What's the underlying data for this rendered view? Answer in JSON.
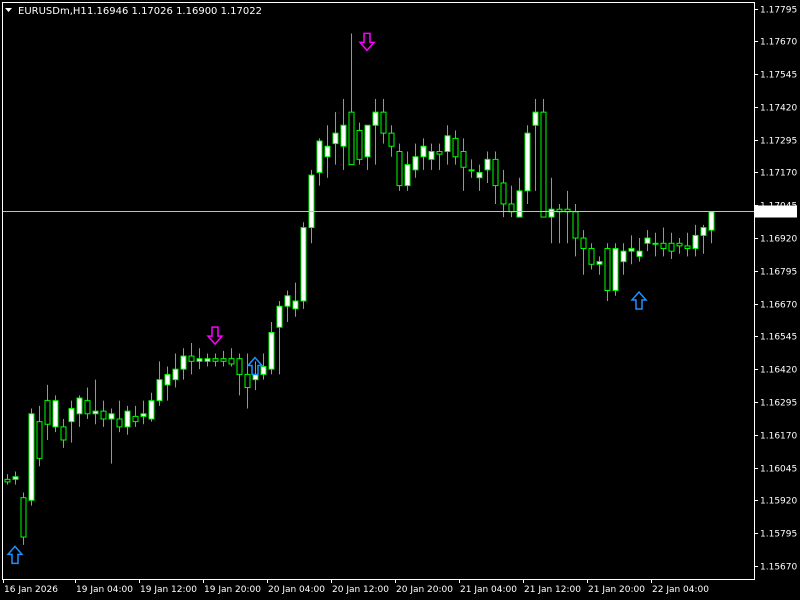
{
  "header": {
    "symbol_timeframe": "EURUSDm,H1",
    "ohlc": "1.16946 1.17026 1.16900 1.17022",
    "menu_icon": "triangle-down-icon"
  },
  "price_tag": "1.17022",
  "colors": {
    "background": "#000000",
    "frame": "#ffffff",
    "candle": "#00ff00",
    "bull_body": "#ffffff",
    "bear_body": "#000000",
    "bid_line": "#c0c0c0",
    "down_arrow": "#ff00ff",
    "up_arrow": "#1e90ff"
  },
  "chart_data": {
    "type": "candlestick",
    "symbol": "EURUSDm",
    "timeframe": "H1",
    "ylim": [
      1.1562,
      1.1782
    ],
    "y_ticks": [
      "1.17795",
      "1.17670",
      "1.17545",
      "1.17420",
      "1.17295",
      "1.17170",
      "1.17045",
      "1.16920",
      "1.16795",
      "1.16670",
      "1.16545",
      "1.16420",
      "1.16295",
      "1.16170",
      "1.16045",
      "1.15920",
      "1.15795",
      "1.15670"
    ],
    "y_tick_values": [
      1.17795,
      1.1767,
      1.17545,
      1.1742,
      1.17295,
      1.1717,
      1.17045,
      1.1692,
      1.16795,
      1.1667,
      1.16545,
      1.1642,
      1.16295,
      1.1617,
      1.16045,
      1.1592,
      1.15795,
      1.1567
    ],
    "x_tick_labels": [
      "16 Jan 2026",
      "19 Jan 04:00",
      "19 Jan 12:00",
      "19 Jan 20:00",
      "20 Jan 04:00",
      "20 Jan 12:00",
      "20 Jan 20:00",
      "21 Jan 04:00",
      "21 Jan 12:00",
      "21 Jan 20:00",
      "22 Jan 04:00"
    ],
    "x_tick_bar_index": [
      0,
      9,
      17,
      25,
      33,
      41,
      49,
      57,
      65,
      73,
      81
    ],
    "current_bid": 1.17022,
    "candles": [
      [
        1.16,
        1.1602,
        1.1598,
        1.1599
      ],
      [
        1.16,
        1.1603,
        1.1598,
        1.1601
      ],
      [
        1.1593,
        1.1595,
        1.1575,
        1.1578
      ],
      [
        1.1592,
        1.1627,
        1.159,
        1.1625
      ],
      [
        1.1622,
        1.1628,
        1.1605,
        1.1608
      ],
      [
        1.163,
        1.1636,
        1.1615,
        1.1621
      ],
      [
        1.162,
        1.1632,
        1.1618,
        1.163
      ],
      [
        1.162,
        1.1623,
        1.1612,
        1.1615
      ],
      [
        1.1622,
        1.163,
        1.1614,
        1.1627
      ],
      [
        1.1625,
        1.1632,
        1.162,
        1.1631
      ],
      [
        1.163,
        1.1635,
        1.1623,
        1.1625
      ],
      [
        1.1625,
        1.1638,
        1.1621,
        1.1626
      ],
      [
        1.1626,
        1.163,
        1.162,
        1.1623
      ],
      [
        1.1623,
        1.1627,
        1.1606,
        1.1625
      ],
      [
        1.1623,
        1.163,
        1.1618,
        1.162
      ],
      [
        1.162,
        1.1628,
        1.1617,
        1.1626
      ],
      [
        1.1624,
        1.1628,
        1.162,
        1.1622
      ],
      [
        1.1624,
        1.163,
        1.1621,
        1.1625
      ],
      [
        1.1623,
        1.1633,
        1.1622,
        1.163
      ],
      [
        1.163,
        1.1645,
        1.1628,
        1.1638
      ],
      [
        1.1636,
        1.1643,
        1.163,
        1.164
      ],
      [
        1.1638,
        1.1648,
        1.1635,
        1.1642
      ],
      [
        1.1642,
        1.165,
        1.1638,
        1.1647
      ],
      [
        1.1647,
        1.1652,
        1.164,
        1.1645
      ],
      [
        1.1645,
        1.165,
        1.1642,
        1.1646
      ],
      [
        1.1645,
        1.1648,
        1.1643,
        1.1646
      ],
      [
        1.1646,
        1.1648,
        1.1643,
        1.1645
      ],
      [
        1.1646,
        1.1649,
        1.1643,
        1.1645
      ],
      [
        1.1646,
        1.165,
        1.1643,
        1.1644
      ],
      [
        1.1646,
        1.1648,
        1.1632,
        1.164
      ],
      [
        1.164,
        1.1648,
        1.1627,
        1.1635
      ],
      [
        1.1638,
        1.1645,
        1.1634,
        1.164
      ],
      [
        1.164,
        1.1648,
        1.1638,
        1.1643
      ],
      [
        1.1642,
        1.166,
        1.164,
        1.1656
      ],
      [
        1.1658,
        1.1668,
        1.164,
        1.1666
      ],
      [
        1.1666,
        1.1672,
        1.166,
        1.167
      ],
      [
        1.1665,
        1.1675,
        1.1662,
        1.1668
      ],
      [
        1.1668,
        1.1698,
        1.1665,
        1.1696
      ],
      [
        1.1696,
        1.1718,
        1.169,
        1.1716
      ],
      [
        1.1717,
        1.173,
        1.1712,
        1.1729
      ],
      [
        1.1723,
        1.1735,
        1.1715,
        1.1727
      ],
      [
        1.1728,
        1.174,
        1.172,
        1.1732
      ],
      [
        1.1727,
        1.1745,
        1.1718,
        1.1735
      ],
      [
        1.174,
        1.177,
        1.172,
        1.172
      ],
      [
        1.1733,
        1.1736,
        1.172,
        1.1722
      ],
      [
        1.1723,
        1.1735,
        1.1718,
        1.1735
      ],
      [
        1.1735,
        1.1745,
        1.172,
        1.174
      ],
      [
        1.174,
        1.1745,
        1.1728,
        1.1732
      ],
      [
        1.1732,
        1.1735,
        1.1723,
        1.1727
      ],
      [
        1.1725,
        1.1728,
        1.171,
        1.1712
      ],
      [
        1.1712,
        1.1725,
        1.171,
        1.172
      ],
      [
        1.1718,
        1.1728,
        1.1715,
        1.1723
      ],
      [
        1.1723,
        1.173,
        1.1718,
        1.1727
      ],
      [
        1.1722,
        1.1728,
        1.1718,
        1.1725
      ],
      [
        1.1725,
        1.1728,
        1.1718,
        1.1724
      ],
      [
        1.1725,
        1.1735,
        1.172,
        1.1731
      ],
      [
        1.173,
        1.1733,
        1.172,
        1.1723
      ],
      [
        1.1725,
        1.173,
        1.171,
        1.1719
      ],
      [
        1.1718,
        1.1722,
        1.1715,
        1.1718
      ],
      [
        1.1715,
        1.172,
        1.171,
        1.1717
      ],
      [
        1.1718,
        1.1725,
        1.1713,
        1.1722
      ],
      [
        1.1722,
        1.1725,
        1.1705,
        1.1712
      ],
      [
        1.1713,
        1.1718,
        1.17,
        1.1705
      ],
      [
        1.1705,
        1.1712,
        1.17,
        1.1702
      ],
      [
        1.17,
        1.1715,
        1.17,
        1.171
      ],
      [
        1.171,
        1.1735,
        1.1705,
        1.1732
      ],
      [
        1.1735,
        1.1745,
        1.171,
        1.174
      ],
      [
        1.174,
        1.1745,
        1.17,
        1.17
      ],
      [
        1.17,
        1.1715,
        1.169,
        1.1703
      ],
      [
        1.1703,
        1.1705,
        1.169,
        1.1702
      ],
      [
        1.1703,
        1.171,
        1.169,
        1.1702
      ],
      [
        1.1702,
        1.1705,
        1.1685,
        1.1692
      ],
      [
        1.1692,
        1.1695,
        1.1678,
        1.1688
      ],
      [
        1.1688,
        1.169,
        1.168,
        1.1682
      ],
      [
        1.1682,
        1.1685,
        1.1678,
        1.1683
      ],
      [
        1.1688,
        1.169,
        1.1668,
        1.1672
      ],
      [
        1.1672,
        1.169,
        1.167,
        1.1688
      ],
      [
        1.1683,
        1.169,
        1.1678,
        1.1687
      ],
      [
        1.1687,
        1.1693,
        1.1682,
        1.1688
      ],
      [
        1.1685,
        1.1692,
        1.1683,
        1.1687
      ],
      [
        1.169,
        1.1695,
        1.1687,
        1.1692
      ],
      [
        1.169,
        1.1694,
        1.1685,
        1.169
      ],
      [
        1.169,
        1.1696,
        1.1685,
        1.1688
      ],
      [
        1.169,
        1.1694,
        1.1684,
        1.1687
      ],
      [
        1.169,
        1.1692,
        1.1686,
        1.1689
      ],
      [
        1.1689,
        1.1694,
        1.1685,
        1.1688
      ],
      [
        1.1688,
        1.1697,
        1.1685,
        1.1693
      ],
      [
        1.1693,
        1.1697,
        1.1686,
        1.1696
      ],
      [
        1.1695,
        1.1702,
        1.169,
        1.1702
      ]
    ],
    "signals": [
      {
        "type": "up",
        "bar": 1,
        "price": 1.1571
      },
      {
        "type": "down",
        "bar": 26,
        "price": 1.1655
      },
      {
        "type": "up",
        "bar": 31,
        "price": 1.1643
      },
      {
        "type": "down",
        "bar": 45,
        "price": 1.1767
      },
      {
        "type": "up",
        "bar": 79,
        "price": 1.1668
      }
    ]
  }
}
